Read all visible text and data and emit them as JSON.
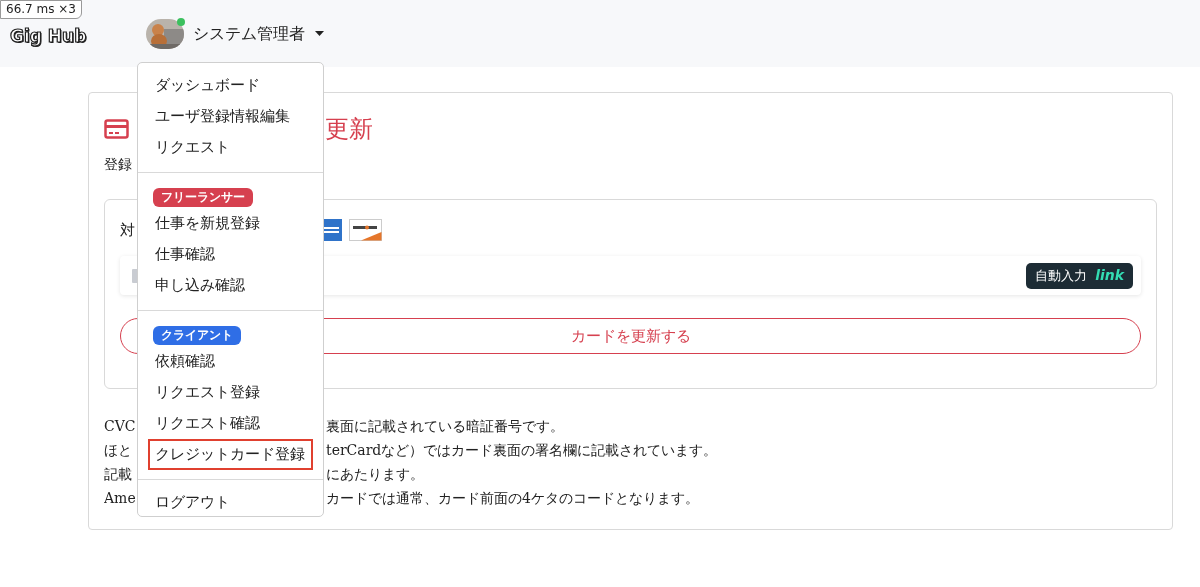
{
  "perf_badge": "66.7 ms ×3",
  "logo": "Gig Hub",
  "user": {
    "name": "システム管理者",
    "online": true
  },
  "page": {
    "title_visible": "更新",
    "subtitle_visible": "登録",
    "card_box": {
      "label_visible": "対",
      "autofill": {
        "label": "自動入力",
        "brand": "link"
      },
      "submit": "カードを更新する"
    },
    "notes": [
      {
        "left": "CVC",
        "right": "裏面に記載されている暗証番号です。"
      },
      {
        "left": "ほと",
        "right": "terCardなど）ではカード裏面の署名欄に記載されています。"
      },
      {
        "left": "記載",
        "right": "にあたります。"
      },
      {
        "left": "Ame",
        "right": "カードでは通常、カード前面の4ケタのコードとなります。"
      }
    ]
  },
  "menu": {
    "sections": [
      {
        "items": [
          {
            "label": "ダッシュボード",
            "highlighted": false
          },
          {
            "label": "ユーザ登録情報編集",
            "highlighted": false
          },
          {
            "label": "リクエスト",
            "highlighted": false
          }
        ]
      },
      {
        "badge": "フリーランサー",
        "color": "#d6404f",
        "items": [
          {
            "label": "仕事を新規登録",
            "highlighted": false
          },
          {
            "label": "仕事確認",
            "highlighted": false
          },
          {
            "label": "申し込み確認",
            "highlighted": false
          }
        ]
      },
      {
        "badge": "クライアント",
        "color": "#2f6ee6",
        "items": [
          {
            "label": "依頼確認",
            "highlighted": false
          },
          {
            "label": "リクエスト登録",
            "highlighted": false
          },
          {
            "label": "リクエスト確認",
            "highlighted": false
          },
          {
            "label": "クレジットカード登録",
            "highlighted": true
          }
        ]
      },
      {
        "items": [
          {
            "label": "ログアウト",
            "highlighted": false
          }
        ]
      }
    ]
  }
}
